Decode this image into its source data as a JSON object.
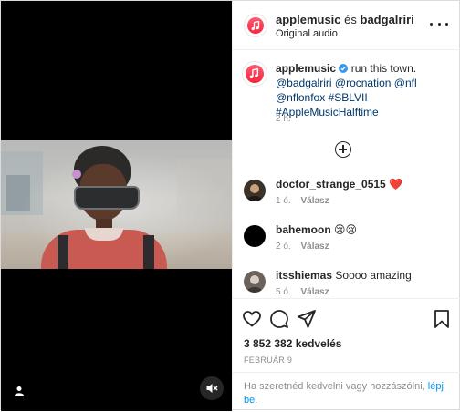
{
  "post": {
    "header": {
      "owner": "applemusic",
      "joiner": "és",
      "collaborator": "badgalriri",
      "audio": "Original audio",
      "avatar_icon": "apple-music-icon",
      "more_icon": "more-options-icon"
    },
    "caption": {
      "username": "applemusic",
      "verified_icon": "verified-badge-icon",
      "text_line1": "run this town.",
      "mentions": [
        "@badgalriri",
        "@rocnation",
        "@nfl",
        "@nflonfox"
      ],
      "hashtags": [
        "#SBLVII",
        "#AppleMusicHalftime"
      ],
      "time": "2 h."
    },
    "load_more_icon": "plus-circle-icon",
    "comments": [
      {
        "username": "doctor_strange_0515",
        "text": "❤️",
        "time": "1 ó.",
        "reply_label": "Válasz",
        "avatar_color": "#3b3228"
      },
      {
        "username": "bahemoon",
        "text": "😢😢",
        "time": "2 ó.",
        "reply_label": "Válasz",
        "avatar_color": "#000000"
      },
      {
        "username": "itsshiemas",
        "text": "Soooo amazing",
        "time": "5 ó.",
        "reply_label": "Válasz",
        "avatar_color": "#6b625c"
      }
    ],
    "actions": {
      "like_icon": "heart-icon",
      "comment_icon": "comment-icon",
      "share_icon": "share-icon",
      "save_icon": "bookmark-icon"
    },
    "likes": "3 852 382 kedvelés",
    "date": "FEBRUÁR 9",
    "login_prompt": "Ha szeretnéd kedvelni vagy hozzászólni,",
    "login_link": "lépj be",
    "login_suffix": "."
  },
  "video": {
    "user_tag_icon": "user-tag-icon",
    "mute_icon": "speaker-muted-icon"
  },
  "colors": {
    "link": "#00376b",
    "login_link": "#0095f6",
    "apple_music_red": "#fa233b",
    "secondary_text": "#8e8e8e"
  }
}
